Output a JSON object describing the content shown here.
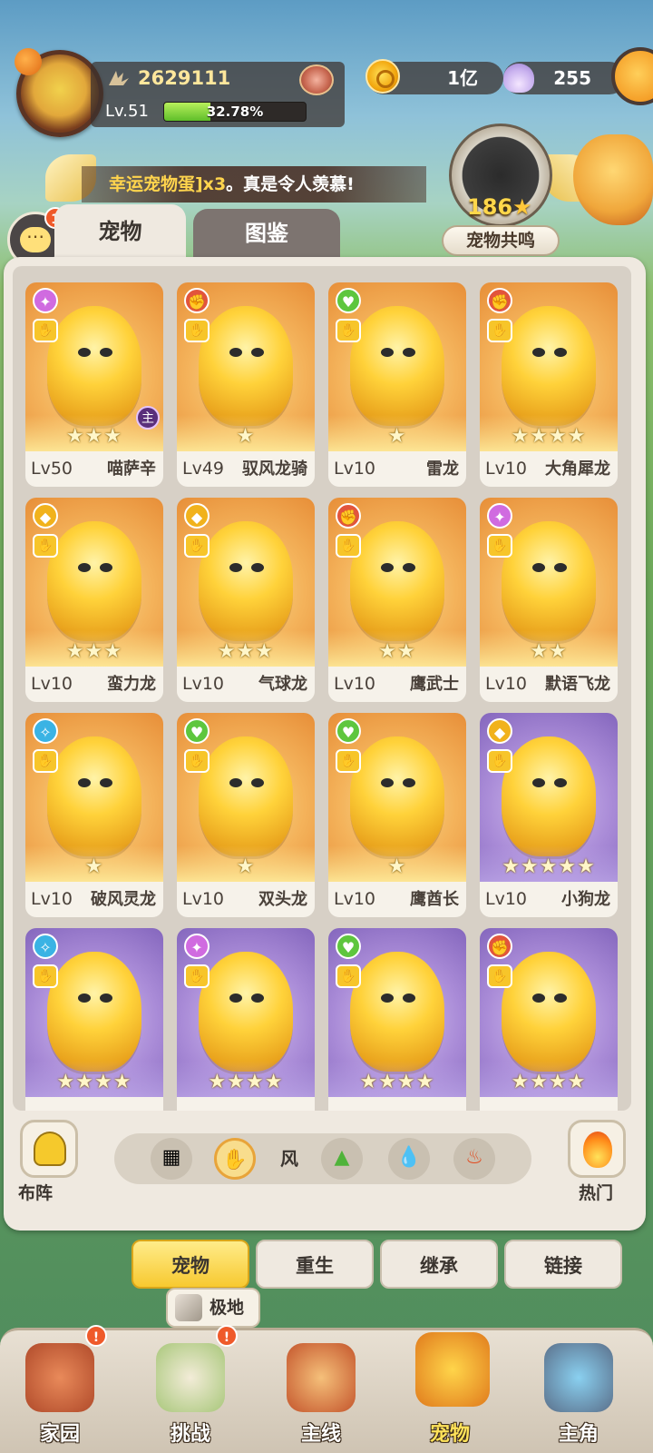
{
  "player": {
    "power": "2629111",
    "level": "Lv.51",
    "xp_percent": "32.78%",
    "xp_fraction": 0.3278
  },
  "resources": {
    "gold": "1亿",
    "shell": "255"
  },
  "banner": {
    "highlight": "幸运宠物蛋]x3",
    "text": "。真是令人羡慕!"
  },
  "resonance": {
    "count": "186",
    "star": "★",
    "label": "宠物共鸣"
  },
  "chat": {
    "badge": "1"
  },
  "tabs": [
    {
      "label": "宠物",
      "active": true
    },
    {
      "label": "图鉴",
      "active": false
    }
  ],
  "cards": [
    {
      "level": "Lv50",
      "name": "喵萨辛",
      "stars": "★★★",
      "element": "thunder",
      "bg": "gold",
      "leader": "主"
    },
    {
      "level": "Lv49",
      "name": "驭风龙骑",
      "stars": "★",
      "element": "fire",
      "bg": "gold"
    },
    {
      "level": "Lv10",
      "name": "雷龙",
      "stars": "★",
      "element": "grass",
      "bg": "gold"
    },
    {
      "level": "Lv10",
      "name": "大角犀龙",
      "stars": "★★★★",
      "element": "fire",
      "bg": "gold"
    },
    {
      "level": "Lv10",
      "name": "蛮力龙",
      "stars": "★★★",
      "element": "wind",
      "bg": "gold"
    },
    {
      "level": "Lv10",
      "name": "气球龙",
      "stars": "★★★",
      "element": "wind",
      "bg": "gold"
    },
    {
      "level": "Lv10",
      "name": "鹰武士",
      "stars": "★★",
      "element": "fire",
      "bg": "gold"
    },
    {
      "level": "Lv10",
      "name": "默语飞龙",
      "stars": "★★",
      "element": "thunder",
      "bg": "gold"
    },
    {
      "level": "Lv10",
      "name": "破风灵龙",
      "stars": "★",
      "element": "water",
      "bg": "gold"
    },
    {
      "level": "Lv10",
      "name": "双头龙",
      "stars": "★",
      "element": "grass",
      "bg": "gold"
    },
    {
      "level": "Lv10",
      "name": "鹰酋长",
      "stars": "★",
      "element": "grass",
      "bg": "gold"
    },
    {
      "level": "Lv10",
      "name": "小狗龙",
      "stars": "★★★★★",
      "element": "wind",
      "bg": "purple"
    },
    {
      "level": "",
      "name": "",
      "stars": "★★★★",
      "element": "water",
      "bg": "purple"
    },
    {
      "level": "",
      "name": "",
      "stars": "★★★★",
      "element": "thunder",
      "bg": "purple"
    },
    {
      "level": "",
      "name": "",
      "stars": "★★★★",
      "element": "grass",
      "bg": "purple"
    },
    {
      "level": "",
      "name": "",
      "stars": "★★★★",
      "element": "fire",
      "bg": "purple"
    }
  ],
  "filter": {
    "formation_label": "布阵",
    "active_label": "风",
    "hot_label": "热门",
    "icons": [
      "all-grid-icon",
      "wind-icon",
      "earth-icon",
      "water-icon",
      "fire-icon"
    ]
  },
  "sub_buttons": [
    {
      "label": "宠物",
      "active": true
    },
    {
      "label": "重生",
      "active": false
    },
    {
      "label": "继承",
      "active": false
    },
    {
      "label": "链接",
      "active": false
    }
  ],
  "tooltip": {
    "label": "极地"
  },
  "nav": [
    {
      "label": "家园",
      "badge": "!",
      "active": false
    },
    {
      "label": "挑战",
      "badge": "!",
      "active": false
    },
    {
      "label": "主线",
      "badge": "",
      "active": false
    },
    {
      "label": "宠物",
      "badge": "",
      "active": true
    },
    {
      "label": "主角",
      "badge": "",
      "active": false
    }
  ],
  "colors": {
    "accent_gold": "#f7c930",
    "xp_green": "#5fbe2a",
    "panel_bg": "#efe9e0",
    "badge_red": "#ef5a2a"
  }
}
